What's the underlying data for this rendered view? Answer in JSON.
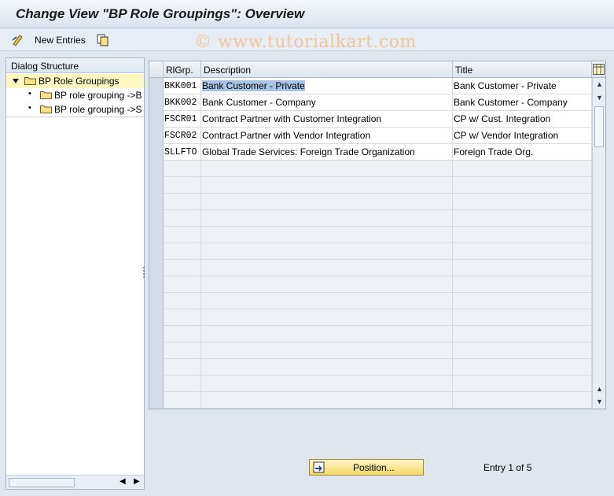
{
  "window": {
    "title": "Change View \"BP Role Groupings\": Overview"
  },
  "toolbar": {
    "new_entries_label": "New Entries",
    "watermark": "© www.tutorialkart.com"
  },
  "dialog_structure": {
    "header": "Dialog Structure",
    "items": [
      {
        "label": "BP Role Groupings",
        "selected": true,
        "level": 0
      },
      {
        "label": "BP role grouping ->B",
        "selected": false,
        "level": 1
      },
      {
        "label": "BP role grouping ->S",
        "selected": false,
        "level": 1
      }
    ]
  },
  "table": {
    "columns": [
      "RlGrp.",
      "Description",
      "Title"
    ],
    "rows": [
      {
        "code": "BKK001",
        "description": "Bank Customer - Private",
        "title": "Bank Customer - Private"
      },
      {
        "code": "BKK002",
        "description": "Bank Customer - Company",
        "title": "Bank Customer - Company"
      },
      {
        "code": "FSCR01",
        "description": "Contract Partner with Customer Integration",
        "title": "CP w/ Cust. Integration"
      },
      {
        "code": "FSCR02",
        "description": "Contract Partner with Vendor Integration",
        "title": "CP w/ Vendor Integration"
      },
      {
        "code": "SLLFTO",
        "description": "Global Trade Services: Foreign Trade Organization",
        "title": "Foreign Trade Org."
      }
    ]
  },
  "footer": {
    "position_button": "Position...",
    "entry_text": "Entry 1 of 5"
  },
  "colors": {
    "selection_highlight": "#a7c4e6",
    "tree_selected": "#fff7c2",
    "button_yellow": "#f4d96a"
  }
}
